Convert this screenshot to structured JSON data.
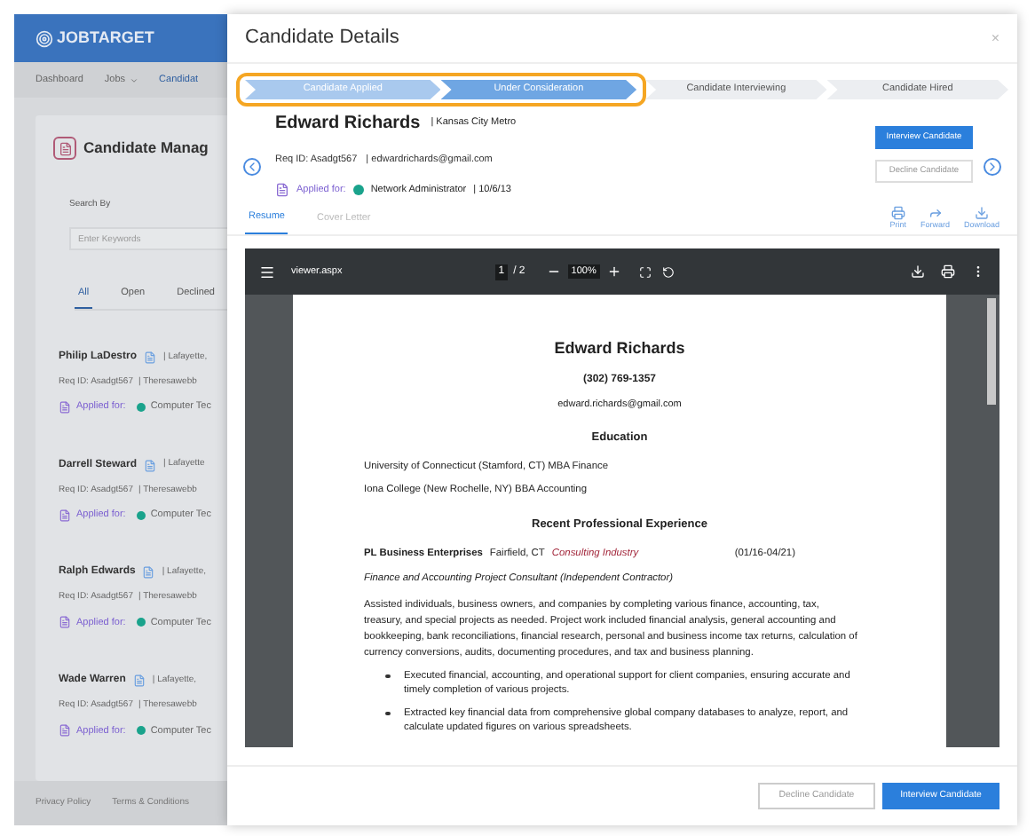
{
  "app": {
    "logo": "JOBTARGET",
    "nav": [
      {
        "label": "Dashboard",
        "selected": false,
        "dropdown": false
      },
      {
        "label": "Jobs",
        "selected": false,
        "dropdown": true
      },
      {
        "label": "Candidat",
        "selected": true,
        "dropdown": false
      }
    ],
    "title": "Candidate Manag",
    "search": {
      "label": "Search By",
      "placeholder": "Enter Keywords"
    },
    "tabs": [
      {
        "label": "All",
        "selected": true
      },
      {
        "label": "Open",
        "selected": false
      },
      {
        "label": "Declined",
        "selected": false
      }
    ],
    "candidates": [
      {
        "name": "Philip LaDestro",
        "location": "| Lafayette,",
        "req": "Req ID: Asadgt567",
        "email": "| Theresawebb",
        "applied_label": "Applied for:",
        "job": "Computer Tec",
        "color": "#1aa38c"
      },
      {
        "name": "Darrell Steward",
        "location": "| Lafayette",
        "req": "Req ID: Asadgt567",
        "email": "| Theresawebb",
        "applied_label": "Applied for:",
        "job": "Computer Tec",
        "color": "#1aa38c"
      },
      {
        "name": "Ralph Edwards",
        "location": "| Lafayette,",
        "req": "Req ID: Asadgt567",
        "email": "| Theresawebb",
        "applied_label": "Applied for:",
        "job": "Computer Tec",
        "color": "#1aa38c"
      },
      {
        "name": "Wade Warren",
        "location": "| Lafayette,",
        "req": "Req ID: Asadgt567",
        "email": "| Theresawebb",
        "applied_label": "Applied for:",
        "job": "Computer Tec",
        "color": "#1aa38c"
      }
    ],
    "footer": [
      "Privacy Policy",
      "Terms & Conditions"
    ]
  },
  "modal": {
    "title": "Candidate Details",
    "close": "×",
    "steps": [
      {
        "label": "Candidate Applied",
        "completed": true,
        "current": false,
        "highlighted": true
      },
      {
        "label": "Under Consideration",
        "completed": true,
        "current": true,
        "highlighted": true
      },
      {
        "label": "Candidate Interviewing",
        "completed": false,
        "current": false,
        "highlighted": false
      },
      {
        "label": "Candidate Hired",
        "completed": false,
        "current": false,
        "highlighted": false
      }
    ],
    "name": "Edward Richards",
    "location": "| Kansas City Metro",
    "req": "Req ID: Asadgt567",
    "email": "| edwardrichards@gmail.com",
    "applied": {
      "label": "Applied for:",
      "job": "Network Administrator",
      "color": "#1aa38c",
      "date": "| 10/6/13"
    },
    "actions": [
      {
        "label": "Interview Candidate",
        "disabled": false
      },
      {
        "label": "Decline Candidate",
        "disabled": true
      }
    ],
    "tabs": [
      {
        "label": "Resume",
        "selected": true
      },
      {
        "label": "Cover Letter",
        "selected": false
      }
    ],
    "tools": [
      {
        "kind": "print",
        "label": "Print"
      },
      {
        "kind": "forward",
        "label": "Forward"
      },
      {
        "kind": "download",
        "label": "Download"
      }
    ],
    "viewer": {
      "file": "viewer.aspx",
      "page": "1",
      "pages": "/ 2",
      "zoom": "100%",
      "resume": [
        {
          "kind": "name",
          "text": "Edward Richards"
        },
        {
          "kind": "contact",
          "text": "(302) 769-1357"
        },
        {
          "kind": "email",
          "text": "edward.richards@gmail.com"
        },
        {
          "kind": "heading",
          "text": "Education"
        },
        {
          "kind": "line",
          "text": "University of Connecticut (Stamford, CT)  MBA Finance"
        },
        {
          "kind": "line",
          "text": "Iona College (New Rochelle, NY)  BBA Accounting"
        },
        {
          "kind": "heading",
          "text": "Recent Professional Experience"
        },
        {
          "kind": "entry",
          "company": "PL Business Enterprises",
          "place": "Fairfield, CT",
          "industry": "Consulting Industry",
          "dates": "(01/16-04/21)"
        },
        {
          "kind": "italic",
          "text": "Finance and Accounting Project Consultant (Independent Contractor)"
        },
        {
          "kind": "paragraph",
          "text": "Assisted individuals, business owners, and companies by completing various finance, accounting, tax, treasury, and special projects as needed.  Project work included financial analysis, general accounting and bookkeeping, bank reconciliations, financial research, personal and business income tax returns, calculation of currency conversions, audits, documenting procedures, and tax and business planning."
        },
        {
          "kind": "bullet",
          "text": "Executed financial, accounting, and operational support for client companies, ensuring accurate and timely completion of various projects."
        },
        {
          "kind": "bullet",
          "text": "Extracted key financial data from comprehensive global company databases to analyze, report, and calculate updated figures on various spreadsheets."
        }
      ]
    },
    "footer_buttons": [
      {
        "label": "Decline Candidate",
        "primary": false
      },
      {
        "label": "Interview Candidate",
        "primary": true
      }
    ]
  }
}
